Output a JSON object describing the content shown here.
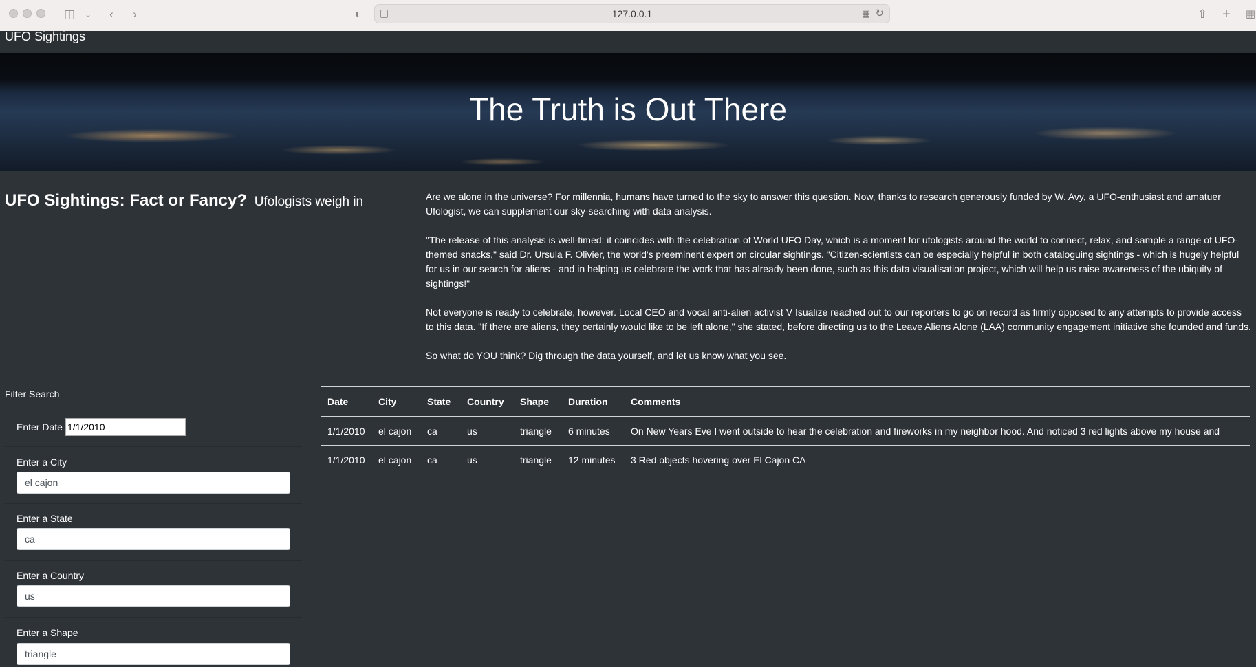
{
  "browser": {
    "url": "127.0.0.1"
  },
  "navbar": {
    "brand": "UFO Sightings"
  },
  "hero": {
    "title": "The Truth is Out There"
  },
  "article": {
    "headline": "UFO Sightings: Fact or Fancy?",
    "subheadline": "Ufologists weigh in",
    "paragraphs": [
      "Are we alone in the universe? For millennia, humans have turned to the sky to answer this question. Now, thanks to research generously funded by W. Avy, a UFO-enthusiast and amatuer Ufologist, we can supplement our sky-searching with data analysis.",
      "\"The release of this analysis is well-timed: it coincides with the celebration of World UFO Day, which is a moment for ufologists around the world to connect, relax, and sample a range of UFO-themed snacks,\" said Dr. Ursula F. Olivier, the world's preeminent expert on circular sightings. \"Citizen-scientists can be especially helpful in both cataloguing sightings - which is hugely helpful for us in our search for aliens - and in helping us celebrate the work that has already been done, such as this data visualisation project, which will help us raise awareness of the ubiquity of sightings!\"",
      "Not everyone is ready to celebrate, however. Local CEO and vocal anti-alien activist V Isualize reached out to our reporters to go on record as firmly opposed to any attempts to provide access to this data. \"If there are aliens, they certainly would like to be left alone,\" she stated, before directing us to the Leave Aliens Alone (LAA) community engagement initiative she founded and funds.",
      "So what do YOU think? Dig through the data yourself, and let us know what you see."
    ]
  },
  "filters": {
    "title": "Filter Search",
    "date": {
      "label": "Enter Date",
      "value": "1/1/2010"
    },
    "city": {
      "label": "Enter a City",
      "value": "el cajon"
    },
    "state": {
      "label": "Enter a State",
      "value": "ca"
    },
    "country": {
      "label": "Enter a Country",
      "value": "us"
    },
    "shape": {
      "label": "Enter a Shape",
      "value": "triangle"
    }
  },
  "table": {
    "headers": [
      "Date",
      "City",
      "State",
      "Country",
      "Shape",
      "Duration",
      "Comments"
    ],
    "rows": [
      [
        "1/1/2010",
        "el cajon",
        "ca",
        "us",
        "triangle",
        "6 minutes",
        "On New Years Eve I went outside to hear the celebration and fireworks in my neighbor hood. And noticed 3 red lights above my house and"
      ],
      [
        "1/1/2010",
        "el cajon",
        "ca",
        "us",
        "triangle",
        "12 minutes",
        "3 Red objects hovering over El Cajon CA"
      ]
    ]
  }
}
